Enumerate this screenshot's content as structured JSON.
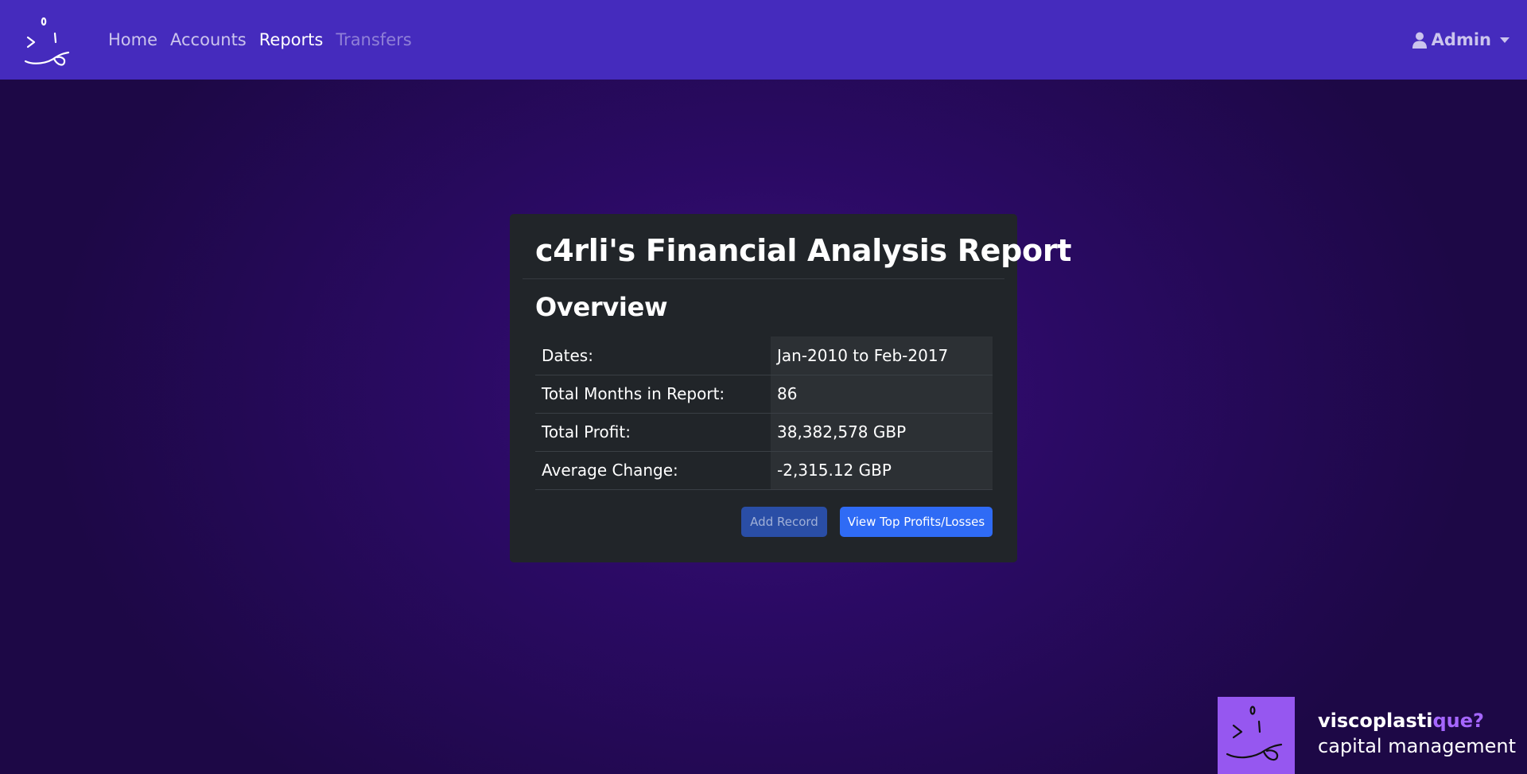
{
  "navbar": {
    "brand_icon": "smiley-face-logo-icon",
    "links": [
      {
        "label": "Home",
        "state": "default"
      },
      {
        "label": "Accounts",
        "state": "default"
      },
      {
        "label": "Reports",
        "state": "active"
      },
      {
        "label": "Transfers",
        "state": "disabled"
      }
    ],
    "user_menu": {
      "label": "Admin",
      "icon": "user-icon"
    }
  },
  "report": {
    "title": "c4rli's Financial Analysis Report",
    "section_heading": "Overview",
    "rows": [
      {
        "label": "Dates:",
        "value": "Jan-2010 to Feb-2017"
      },
      {
        "label": "Total Months in Report:",
        "value": "86"
      },
      {
        "label": "Total Profit:",
        "value": "38,382,578 GBP"
      },
      {
        "label": "Average Change:",
        "value": "-2,315.12 GBP"
      }
    ],
    "buttons": {
      "add_record": "Add Record",
      "view_top": "View Top Profits/Losses"
    }
  },
  "footer": {
    "name_main": "viscoplasti",
    "name_accent": "que?",
    "tagline": "capital management"
  },
  "colors": {
    "navbar": "#452bbd",
    "background": "#2a0a63",
    "card": "#212529",
    "primary_button": "#2f6bf5",
    "footer_logo": "#9657f0",
    "footer_accent": "#a566ff"
  }
}
